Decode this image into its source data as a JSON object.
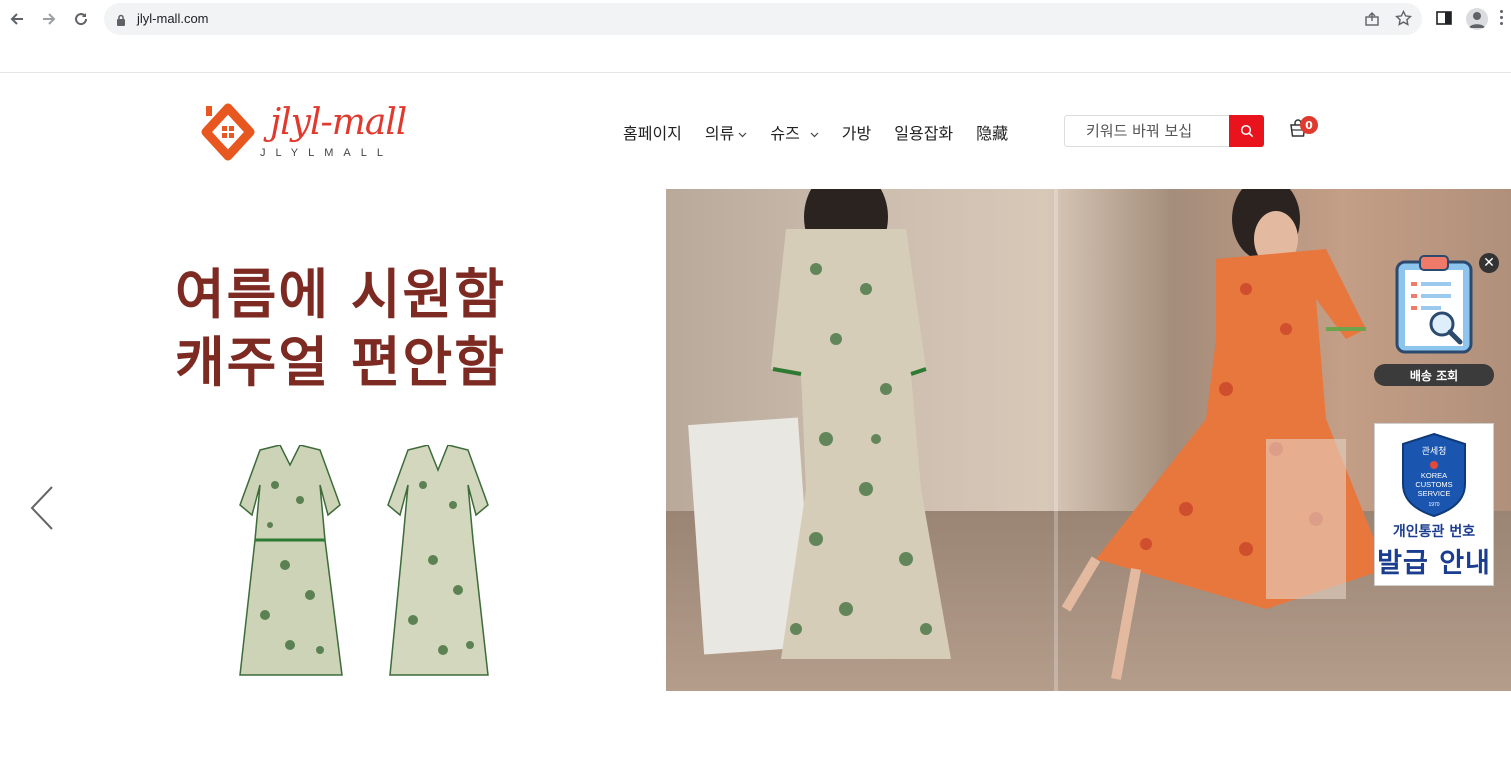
{
  "browser": {
    "url": "jlyl-mall.com"
  },
  "header": {
    "logo_text": "jlyl-mall",
    "logo_sub": "JLYLMALL",
    "menu": [
      {
        "label": "홈페이지",
        "dropdown": false
      },
      {
        "label": "의류",
        "dropdown": true
      },
      {
        "label": "슈즈",
        "dropdown": true
      },
      {
        "label": "가방",
        "dropdown": false
      },
      {
        "label": "일용잡화",
        "dropdown": false
      },
      {
        "label": "隐藏",
        "dropdown": false
      }
    ],
    "search_placeholder": "키워드 바꿔 보십",
    "cart_count": "0"
  },
  "banner": {
    "headline_line1": "여름에 시원함",
    "headline_line2": "캐주얼 편안함"
  },
  "widgets": {
    "shipping_label": "배송 조회",
    "customs_title": "관세청",
    "customs_shield_l1": "KOREA",
    "customs_shield_l2": "CUSTOMS",
    "customs_shield_l3": "SERVICE",
    "customs_shield_year": "1970",
    "customs_line1": "개인통관 번호",
    "customs_line2": "발급 안내"
  },
  "colors": {
    "brand": "#e03a2f",
    "headline": "#7c2a22",
    "search_button": "#e8131c",
    "customs_blue": "#1a3d8f"
  }
}
